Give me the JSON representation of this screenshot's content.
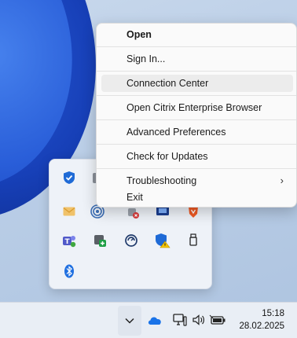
{
  "context_menu": {
    "items": [
      {
        "label": "Open"
      },
      {
        "label": "Sign In..."
      },
      {
        "label": "Connection Center"
      },
      {
        "label": "Open Citrix Enterprise Browser"
      },
      {
        "label": "Advanced Preferences"
      },
      {
        "label": "Check for Updates"
      },
      {
        "label": "Troubleshooting"
      },
      {
        "label": "Exit"
      }
    ]
  },
  "tray_flyout": {
    "icons": [
      "defender-shield-icon",
      "app-icon",
      "mail-icon",
      "citrix-icon",
      "app-badge-icon",
      "monitor-app-icon",
      "brave-icon",
      "teams-icon",
      "app-add-icon",
      "sync-icon",
      "defender-warning-icon",
      "usb-eject-icon",
      "bluetooth-icon"
    ]
  },
  "taskbar": {
    "time": "15:18",
    "date": "28.02.2025"
  },
  "colors": {
    "accent_blue": "#1a73e8",
    "menu_bg": "#fafafa",
    "hover_bg": "#ececec"
  }
}
